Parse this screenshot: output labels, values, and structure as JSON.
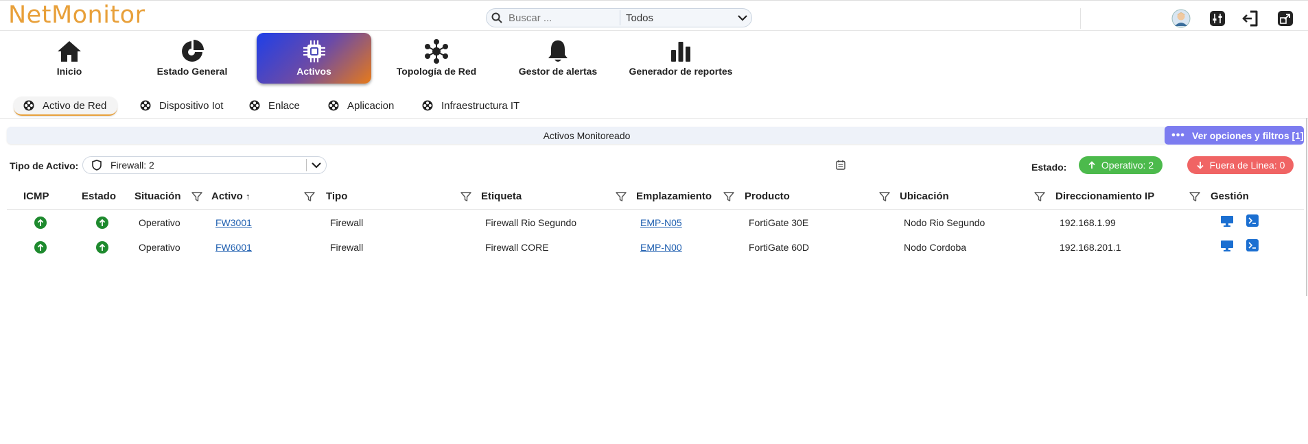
{
  "app": {
    "logo": "NetMonitor"
  },
  "search": {
    "placeholder": "Buscar ...",
    "scope": "Todos"
  },
  "nav": [
    {
      "label": "Inicio",
      "icon": "home-icon"
    },
    {
      "label": "Estado General",
      "icon": "pie-icon"
    },
    {
      "label": "Activos",
      "icon": "chip-icon",
      "active": true
    },
    {
      "label": "Topología de Red",
      "icon": "network-icon"
    },
    {
      "label": "Gestor de alertas",
      "icon": "bell-icon"
    },
    {
      "label": "Generador de reportes",
      "icon": "bar-chart-icon"
    }
  ],
  "subtabs": [
    {
      "label": "Activo de Red",
      "active": true
    },
    {
      "label": "Dispositivo Iot"
    },
    {
      "label": "Enlace"
    },
    {
      "label": "Aplicacion"
    },
    {
      "label": "Infraestructura IT"
    }
  ],
  "panel": {
    "title": "Activos Monitoreado",
    "options_label": "Ver opciones y filtros [1]"
  },
  "filter": {
    "type_label": "Tipo de Activo:",
    "type_value": "Firewall: 2"
  },
  "status": {
    "label": "Estado:",
    "online": "Operativo: 2",
    "offline": "Fuera de Linea: 0"
  },
  "table": {
    "headers": [
      "ICMP",
      "Estado",
      "Situación",
      "Activo",
      "Tipo",
      "Etiqueta",
      "Emplazamiento",
      "Producto",
      "Ubicación",
      "Direccionamiento IP",
      "Gestión"
    ],
    "sort_glyph": "↑",
    "rows": [
      {
        "situacion": "Operativo",
        "activo": "FW3001",
        "tipo": "Firewall",
        "etiqueta": "Firewall Rio Segundo",
        "emplazamiento": "EMP-N05",
        "producto": "FortiGate 30E",
        "ubicacion": "Nodo Rio Segundo",
        "ip": "192.168.1.99"
      },
      {
        "situacion": "Operativo",
        "activo": "FW6001",
        "tipo": "Firewall",
        "etiqueta": "Firewall CORE",
        "emplazamiento": "EMP-N00",
        "producto": "FortiGate 60D",
        "ubicacion": "Nodo Cordoba",
        "ip": "192.168.201.1"
      }
    ]
  },
  "colors": {
    "brand": "#e8a03a",
    "online": "#4cba4c",
    "offline": "#f06464",
    "up": "#1e8a2e",
    "link": "#1f5fb0",
    "accent": "#7c7cf0"
  }
}
